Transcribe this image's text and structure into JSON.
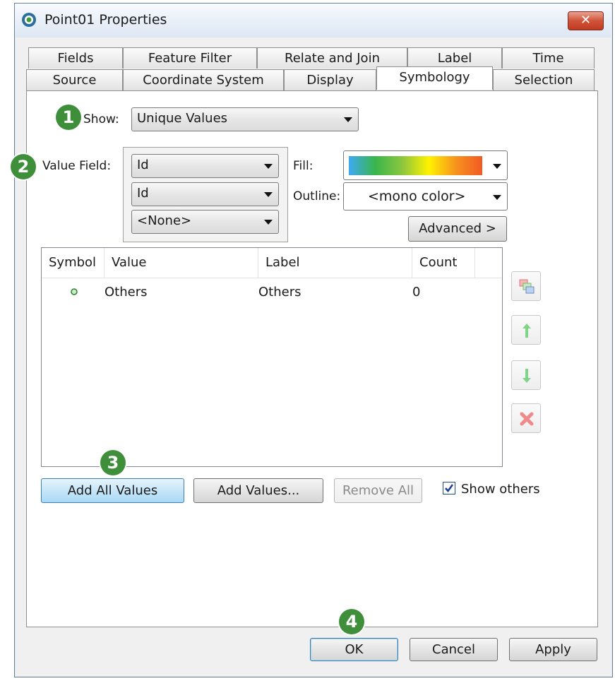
{
  "window": {
    "title": "Point01  Properties"
  },
  "tabs_row1": [
    "Fields",
    "Feature Filter",
    "Relate and Join",
    "Label",
    "Time"
  ],
  "tabs_row2": [
    "Source",
    "Coordinate System",
    "Display",
    "Symbology",
    "Selection"
  ],
  "active_tab": "Symbology",
  "symbology": {
    "show_label": "Show:",
    "show_value": "Unique Values",
    "value_field_label": "Value Field:",
    "value_fields": [
      "Id",
      "Id",
      "<None>"
    ],
    "fill_label": "Fill:",
    "outline_label": "Outline:",
    "outline_value": "<mono color>",
    "advanced_button": "Advanced >",
    "fill_ramp_colors": [
      "#3fa9f5",
      "#39b54a",
      "#8cc63f",
      "#fff200",
      "#f7931e",
      "#f15a24"
    ],
    "table": {
      "columns": [
        "Symbol",
        "Value",
        "Label",
        "Count"
      ],
      "rows": [
        {
          "symbol_color": "#2e7d32",
          "value": "Others",
          "label": "Others",
          "count": "0"
        }
      ]
    },
    "add_all_button": "Add All Values",
    "add_values_button": "Add Values...",
    "remove_all_button": "Remove All",
    "show_others_label": "Show others",
    "show_others_checked": true
  },
  "footer": {
    "ok": "OK",
    "cancel": "Cancel",
    "apply": "Apply"
  },
  "badges": [
    "1",
    "2",
    "3",
    "4"
  ]
}
